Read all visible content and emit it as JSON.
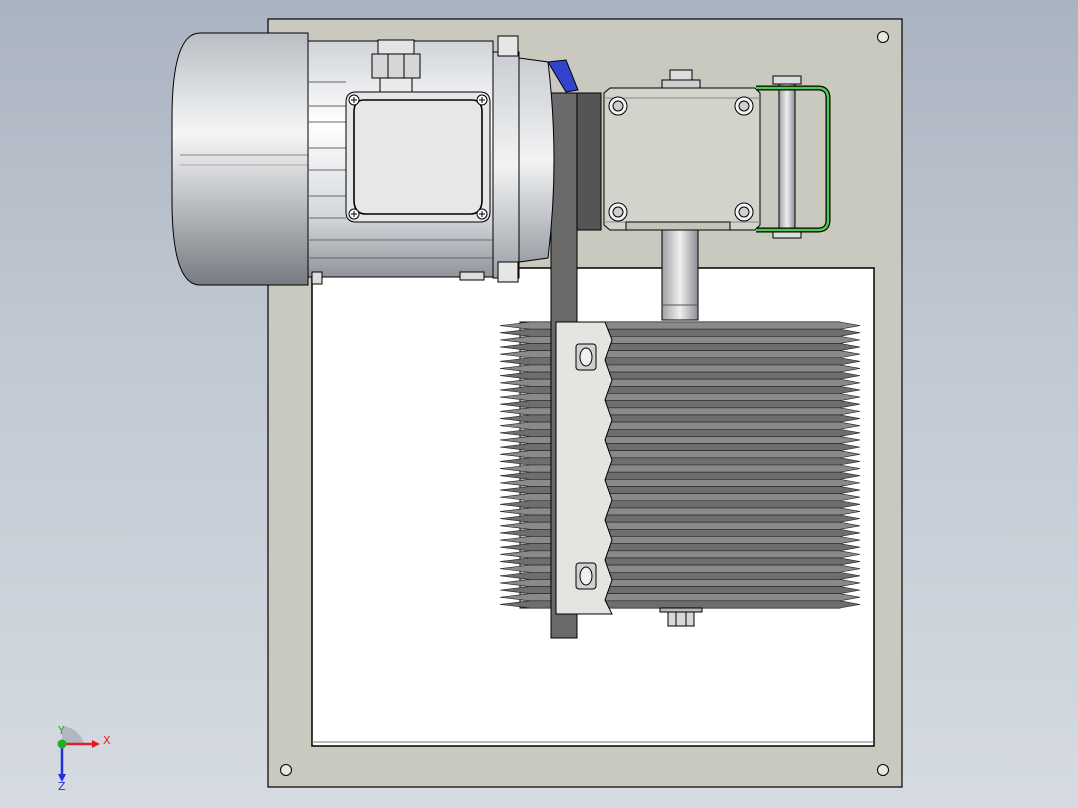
{
  "view": {
    "background_top": "#aab3c0",
    "background_bottom": "#d6dbe2",
    "plate_color": "#c9c9bf",
    "edge_color": "#000000",
    "bracket_color": "#5f5f5f",
    "guard_color": "#4fc94f",
    "flange_color": "#3344cc"
  },
  "triad": {
    "x_label": "X",
    "y_label": "Y",
    "z_label": "Z",
    "x_color": "#e02020",
    "y_color": "#20b020",
    "z_color": "#2030e0"
  },
  "model": {
    "parts": [
      "base-plate",
      "inspection-opening",
      "electric-motor",
      "terminal-box",
      "cable-gland",
      "motor-flange",
      "mounting-bracket",
      "gearbox",
      "guard-handle",
      "output-shaft",
      "heat-sink",
      "clamp-plate",
      "hex-nut"
    ],
    "heat_sink_fin_count": 40
  }
}
